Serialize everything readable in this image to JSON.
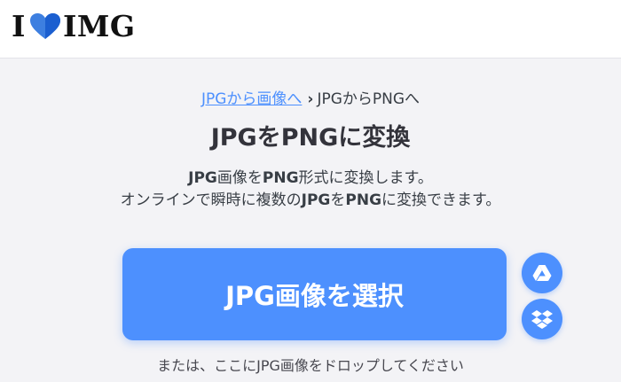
{
  "header": {
    "logo_left": "I",
    "logo_right": "IMG"
  },
  "breadcrumb": {
    "parent_link": "JPGから画像へ",
    "separator": "›",
    "current": "JPGからPNGへ"
  },
  "page": {
    "title": "JPGをPNGに変換",
    "description": {
      "line1": [
        "JPG",
        "画像を",
        "PNG",
        "形式に変換します。"
      ],
      "line2": [
        "オンラインで瞬時に複数の",
        "JPG",
        "を",
        "PNG",
        "に変換できます。"
      ]
    }
  },
  "upload": {
    "select_button_label": "JPG画像を選択",
    "drop_hint": "または、ここにJPG画像をドロップしてください",
    "cloud_buttons": [
      {
        "service": "google-drive",
        "icon": "google-drive-icon"
      },
      {
        "service": "dropbox",
        "icon": "dropbox-icon"
      }
    ]
  },
  "colors": {
    "accent": "#4d90fe",
    "header_bg": "#ffffff",
    "page_bg": "#f3f3f6",
    "text": "#383e45"
  }
}
